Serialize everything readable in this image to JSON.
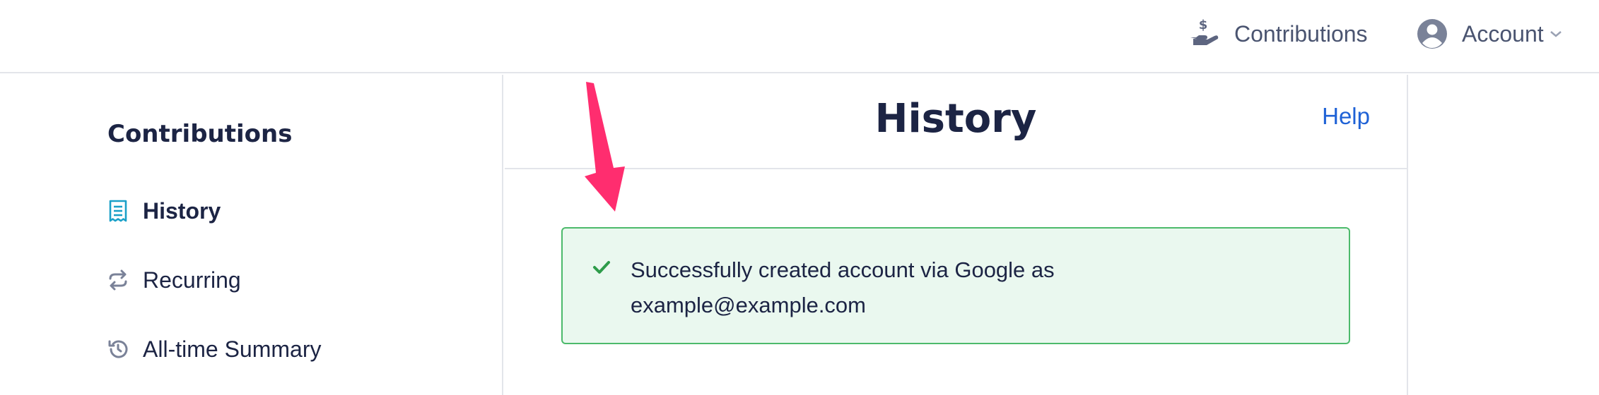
{
  "topnav": {
    "contributions_label": "Contributions",
    "account_label": "Account",
    "contributions_icon": "hand-dollar-icon",
    "account_icon": "user-circle-icon",
    "account_chevron_icon": "chevron-down-icon"
  },
  "sidebar": {
    "heading": "Contributions",
    "items": [
      {
        "label": "History",
        "icon": "receipt-icon",
        "active": true
      },
      {
        "label": "Recurring",
        "icon": "repeat-icon",
        "active": false
      },
      {
        "label": "All-time Summary",
        "icon": "history-icon",
        "active": false
      }
    ]
  },
  "main": {
    "title": "History",
    "help_label": "Help",
    "alert": {
      "line1": "Successfully created account via Google as",
      "line2": "example@example.com",
      "icon": "check-icon"
    }
  },
  "colors": {
    "accent_link": "#1f62d6",
    "success_bg": "#eaf8ef",
    "success_border": "#4cba6b",
    "success_check": "#2e9c4a",
    "annotation_arrow": "#ff2d6f",
    "active_icon": "#1aa0c8"
  }
}
